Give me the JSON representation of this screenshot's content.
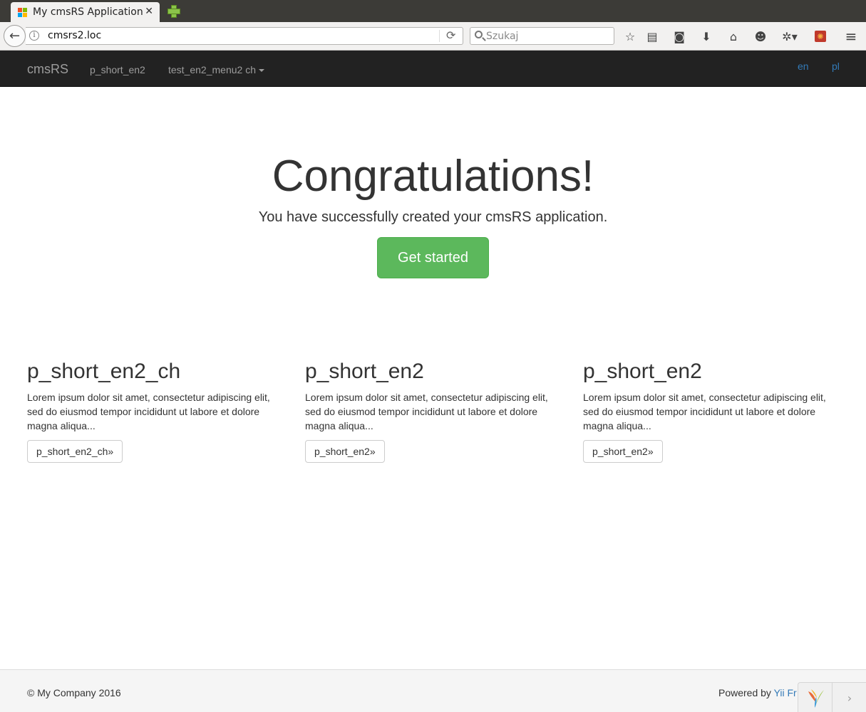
{
  "browser": {
    "tab_title": "My cmsRS Application",
    "tab_close": "✕",
    "url": "cmsrs2.loc",
    "search_placeholder": "Szukaj"
  },
  "icons": {
    "back": "back-arrow-icon",
    "info": "info-icon",
    "reload": "reload-icon",
    "search": "search-icon",
    "bookmark": "star-icon",
    "reading_list": "clipboard-icon",
    "pocket": "pocket-icon",
    "downloads": "download-icon",
    "home": "home-icon",
    "chat": "smiley-icon",
    "extension": "bug-icon",
    "ubuntu": "ubuntu-icon",
    "menu": "hamburger-menu-icon"
  },
  "site_nav": {
    "brand": "cmsRS",
    "items": [
      {
        "label": "p_short_en2"
      },
      {
        "label": "test_en2_menu2 ch"
      }
    ],
    "languages": [
      "en",
      "pl"
    ]
  },
  "jumbotron": {
    "title": "Congratulations!",
    "lead": "You have successfully created your cmsRS application.",
    "button": "Get started"
  },
  "columns": [
    {
      "heading": "p_short_en2_ch",
      "text": "Lorem ipsum dolor sit amet, consectetur adipiscing elit, sed do eiusmod tempor incididunt ut labore et dolore magna aliqua...",
      "button": "p_short_en2_ch»"
    },
    {
      "heading": "p_short_en2",
      "text": "Lorem ipsum dolor sit amet, consectetur adipiscing elit, sed do eiusmod tempor incididunt ut labore et dolore magna aliqua...",
      "button": "p_short_en2»"
    },
    {
      "heading": "p_short_en2",
      "text": "Lorem ipsum dolor sit amet, consectetur adipiscing elit, sed do eiusmod tempor incididunt ut labore et dolore magna aliqua...",
      "button": "p_short_en2»"
    }
  ],
  "footer": {
    "copyright": "© My Company 2016",
    "powered_by": "Powered by",
    "framework_link": "Yii Fr"
  },
  "colors": {
    "navbar_bg": "#222222",
    "nav_text": "#9d9d9d",
    "link": "#337ab7",
    "success": "#5cb85c",
    "footer_bg": "#f5f5f5"
  }
}
